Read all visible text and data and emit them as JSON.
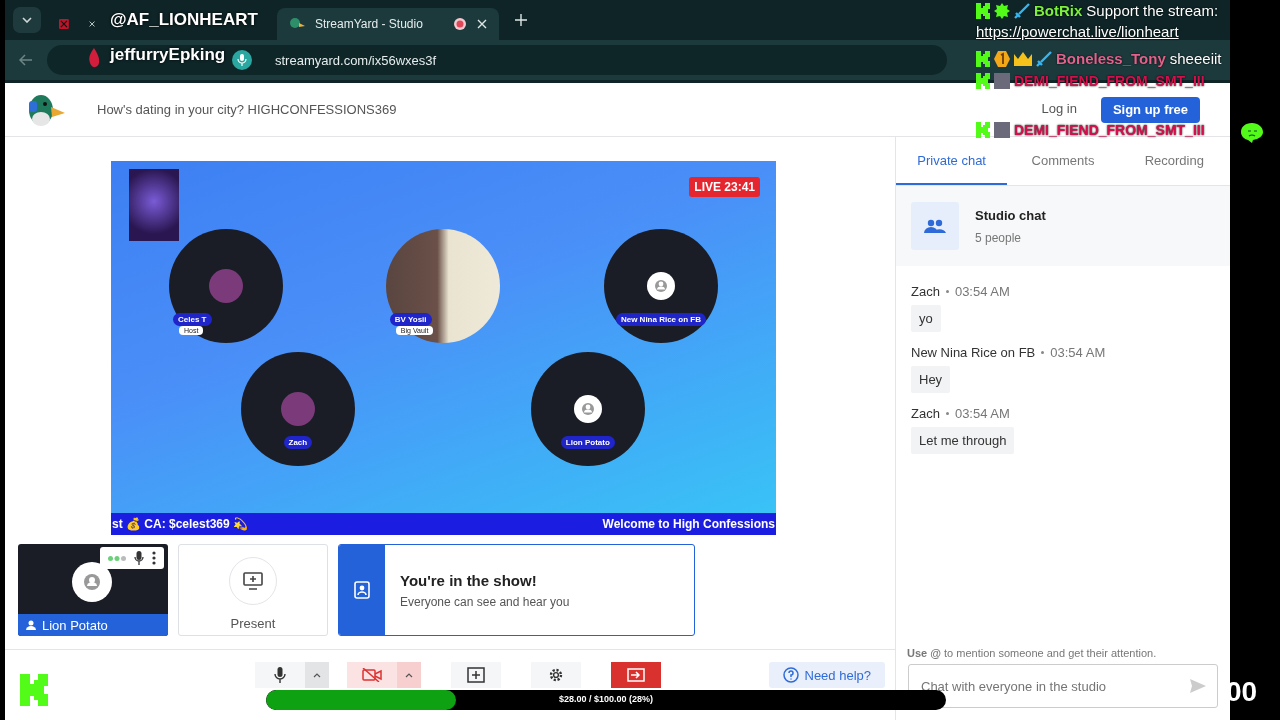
{
  "browser": {
    "tabs": [
      {
        "kind": "x",
        "selected": false
      },
      {
        "kind": "duck",
        "title": "StreamYard - Studio",
        "selected": true,
        "recording": true
      }
    ],
    "url": "streamyard.com/ix56wxes3f"
  },
  "header": {
    "title": "How's dating in your city? HIGHCONFESSIONS369",
    "login": "Log in",
    "signup": "Sign up free"
  },
  "stage": {
    "live": "LIVE 23:41",
    "participants": [
      {
        "name": "Celes T",
        "role": "Host",
        "kind": "avatar"
      },
      {
        "name": "BV Yosii",
        "role": "Big Vault",
        "kind": "video"
      },
      {
        "name": "New Nina Rice on FB",
        "kind": "placeholder"
      },
      {
        "name": "Zach",
        "kind": "avatar"
      },
      {
        "name": "Lion Potato",
        "kind": "placeholder"
      }
    ],
    "ticker": [
      "st 💰 CA: $celest369 💫",
      "Welcome to High Confessions"
    ]
  },
  "self_tile": {
    "name": "Lion Potato"
  },
  "present": {
    "label": "Present"
  },
  "notice": {
    "title": "You're in the show!",
    "text": "Everyone can see and hear you"
  },
  "controls": [
    {
      "kind": "mic",
      "caret": true
    },
    {
      "kind": "camera-off",
      "caret": true
    },
    {
      "kind": "add",
      "caret": false
    },
    {
      "kind": "settings",
      "caret": false
    },
    {
      "kind": "leave",
      "caret": false
    }
  ],
  "help": "Need help?",
  "panel": {
    "tabs": [
      {
        "label": "Private chat",
        "selected": true
      },
      {
        "label": "Comments",
        "selected": false
      },
      {
        "label": "Recording",
        "selected": false
      }
    ],
    "group": {
      "title": "Studio chat",
      "count": "5 people"
    },
    "messages": [
      {
        "author": "Zach",
        "time": "03:54 AM",
        "text": "yo"
      },
      {
        "author": "New Nina Rice on FB",
        "time": "03:54 AM",
        "text": "Hey"
      },
      {
        "author": "Zach",
        "time": "03:54 AM",
        "text": "Let me through"
      }
    ],
    "hint": "**Use @** to mention someone and get their attention.",
    "placeholder": "Chat with everyone in the studio"
  },
  "overlay": {
    "names": [
      "@AF_LIONHEART",
      "jeffurryEpking"
    ],
    "chat": [
      {
        "user": "BotRix",
        "color": "#7cf03c",
        "badges": [
          {
            "kind": "kick"
          },
          {
            "kind": "verified"
          },
          {
            "kind": "sword"
          }
        ],
        "text": "Support the stream:",
        "link": "https://powerchat.live/lionheart"
      },
      {
        "user": "Boneless_Tony",
        "color": "#e2628c",
        "badges": [
          {
            "kind": "kick"
          },
          {
            "kind": "one"
          },
          {
            "kind": "crown"
          },
          {
            "kind": "sword"
          }
        ],
        "text": "sheeeiit"
      },
      {
        "user": "DEMI_FIEND_FROM_SMT_III",
        "color": "#d4104c",
        "badges": [
          {
            "kind": "kick"
          },
          {
            "kind": "avatar"
          }
        ]
      },
      {
        "user": "DEMI_FIEND_FROM_SMT_III",
        "color": "#d4104c",
        "badges": [
          {
            "kind": "kick"
          },
          {
            "kind": "avatar"
          }
        ]
      }
    ],
    "goal": {
      "label": "$28.00 / $100.00 (28%)",
      "level": 0.28
    },
    "counter": "00"
  }
}
